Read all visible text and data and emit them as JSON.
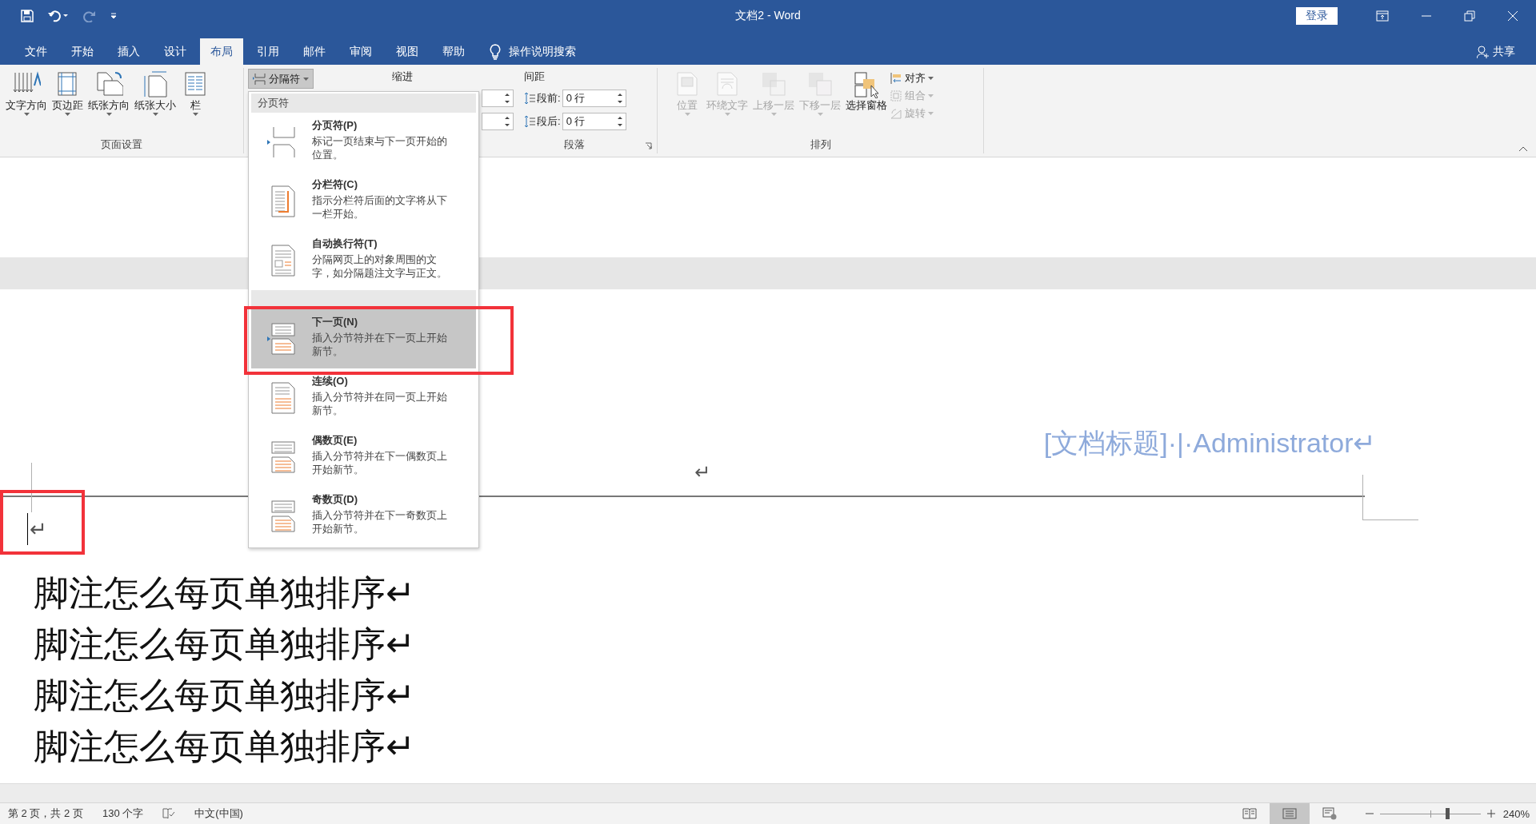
{
  "title_bar": {
    "title": "文档2 - Word",
    "sign_in": "登录"
  },
  "menu_tabs": [
    {
      "label": "文件",
      "selected": false
    },
    {
      "label": "开始",
      "selected": false
    },
    {
      "label": "插入",
      "selected": false
    },
    {
      "label": "设计",
      "selected": false
    },
    {
      "label": "布局",
      "selected": true
    },
    {
      "label": "引用",
      "selected": false
    },
    {
      "label": "邮件",
      "selected": false
    },
    {
      "label": "审阅",
      "selected": false
    },
    {
      "label": "视图",
      "selected": false
    },
    {
      "label": "帮助",
      "selected": false
    }
  ],
  "tell_me": "操作说明搜索",
  "share": "共享",
  "ribbon": {
    "page_setup": {
      "label": "页面设置",
      "buttons": [
        {
          "kind": "direction",
          "label": "文字方向",
          "dropdown": true
        },
        {
          "kind": "margins",
          "label": "页边距",
          "dropdown": true
        },
        {
          "kind": "orientation",
          "label": "纸张方向",
          "dropdown": true
        },
        {
          "kind": "size",
          "label": "纸张大小",
          "dropdown": true
        },
        {
          "kind": "columns",
          "label": "栏",
          "dropdown": true
        }
      ]
    },
    "breaks_button": {
      "label": "分隔符",
      "pressed": true
    },
    "paragraph": {
      "label": "段落",
      "indent_label": "缩进",
      "spacing_label": "间距",
      "spacing": [
        {
          "label": "段前:",
          "value": "0 行"
        },
        {
          "label": "段后:",
          "value": "0 行"
        }
      ]
    },
    "arrange": {
      "label": "排列",
      "buttons": [
        {
          "kind": "position",
          "label": "位置",
          "disabled": true,
          "dropdown": true
        },
        {
          "kind": "wrap",
          "label": "环绕文字",
          "disabled": true,
          "dropdown": true
        },
        {
          "kind": "forward",
          "label": "上移一层",
          "disabled": true,
          "dropdown": true
        },
        {
          "kind": "backward",
          "label": "下移一层",
          "disabled": true,
          "dropdown": true
        },
        {
          "kind": "pane",
          "label": "选择窗格",
          "disabled": false,
          "dropdown": false
        }
      ],
      "small_buttons": [
        {
          "kind": "align",
          "label": "对齐",
          "disabled": false
        },
        {
          "kind": "group",
          "label": "组合",
          "disabled": true
        },
        {
          "kind": "rotate",
          "label": "旋转",
          "disabled": true
        }
      ]
    }
  },
  "breaks_menu": {
    "sections": [
      {
        "header": "分页符",
        "items": [
          {
            "kind": "page",
            "title": "分页符(P)",
            "description": "标记一页结束与下一页开始的位置。",
            "selected": false,
            "annotated": false
          },
          {
            "kind": "column",
            "title": "分栏符(C)",
            "description": "指示分栏符后面的文字将从下一栏开始。",
            "selected": false,
            "annotated": false
          },
          {
            "kind": "wrap",
            "title": "自动换行符(T)",
            "description": "分隔网页上的对象周围的文字，如分隔题注文字与正文。",
            "selected": false,
            "annotated": false
          }
        ]
      },
      {
        "items": [
          {
            "kind": "next",
            "title": "下一页(N)",
            "description": "插入分节符并在下一页上开始新节。",
            "selected": true,
            "annotated": true
          },
          {
            "kind": "continuous",
            "title": "连续(O)",
            "description": "插入分节符并在同一页上开始新节。",
            "selected": false,
            "annotated": false
          },
          {
            "kind": "even",
            "title": "偶数页(E)",
            "description": "插入分节符并在下一偶数页上开始新节。",
            "selected": false,
            "annotated": false
          },
          {
            "kind": "odd",
            "title": "奇数页(D)",
            "description": "插入分节符并在下一奇数页上开始新节。",
            "selected": false,
            "annotated": false
          }
        ]
      }
    ]
  },
  "document": {
    "header_text": "[文档标题]·|·Administrator↵",
    "header_mark": "↵",
    "cursor_mark": {
      "text": "↵",
      "annotated": true
    },
    "lines": [
      "脚注怎么每页单独排序↵",
      "脚注怎么每页单独排序↵",
      "脚注怎么每页单独排序↵",
      "脚注怎么每页单独排序↵"
    ]
  },
  "status_bar": {
    "page": "第 2 页，共 2 页",
    "words": "130 个字",
    "language": "中文(中国)",
    "views": [
      {
        "kind": "read",
        "selected": false
      },
      {
        "kind": "print",
        "selected": true
      },
      {
        "kind": "web",
        "selected": false
      }
    ],
    "zoom": {
      "level": 0.67,
      "label": "240%"
    }
  }
}
